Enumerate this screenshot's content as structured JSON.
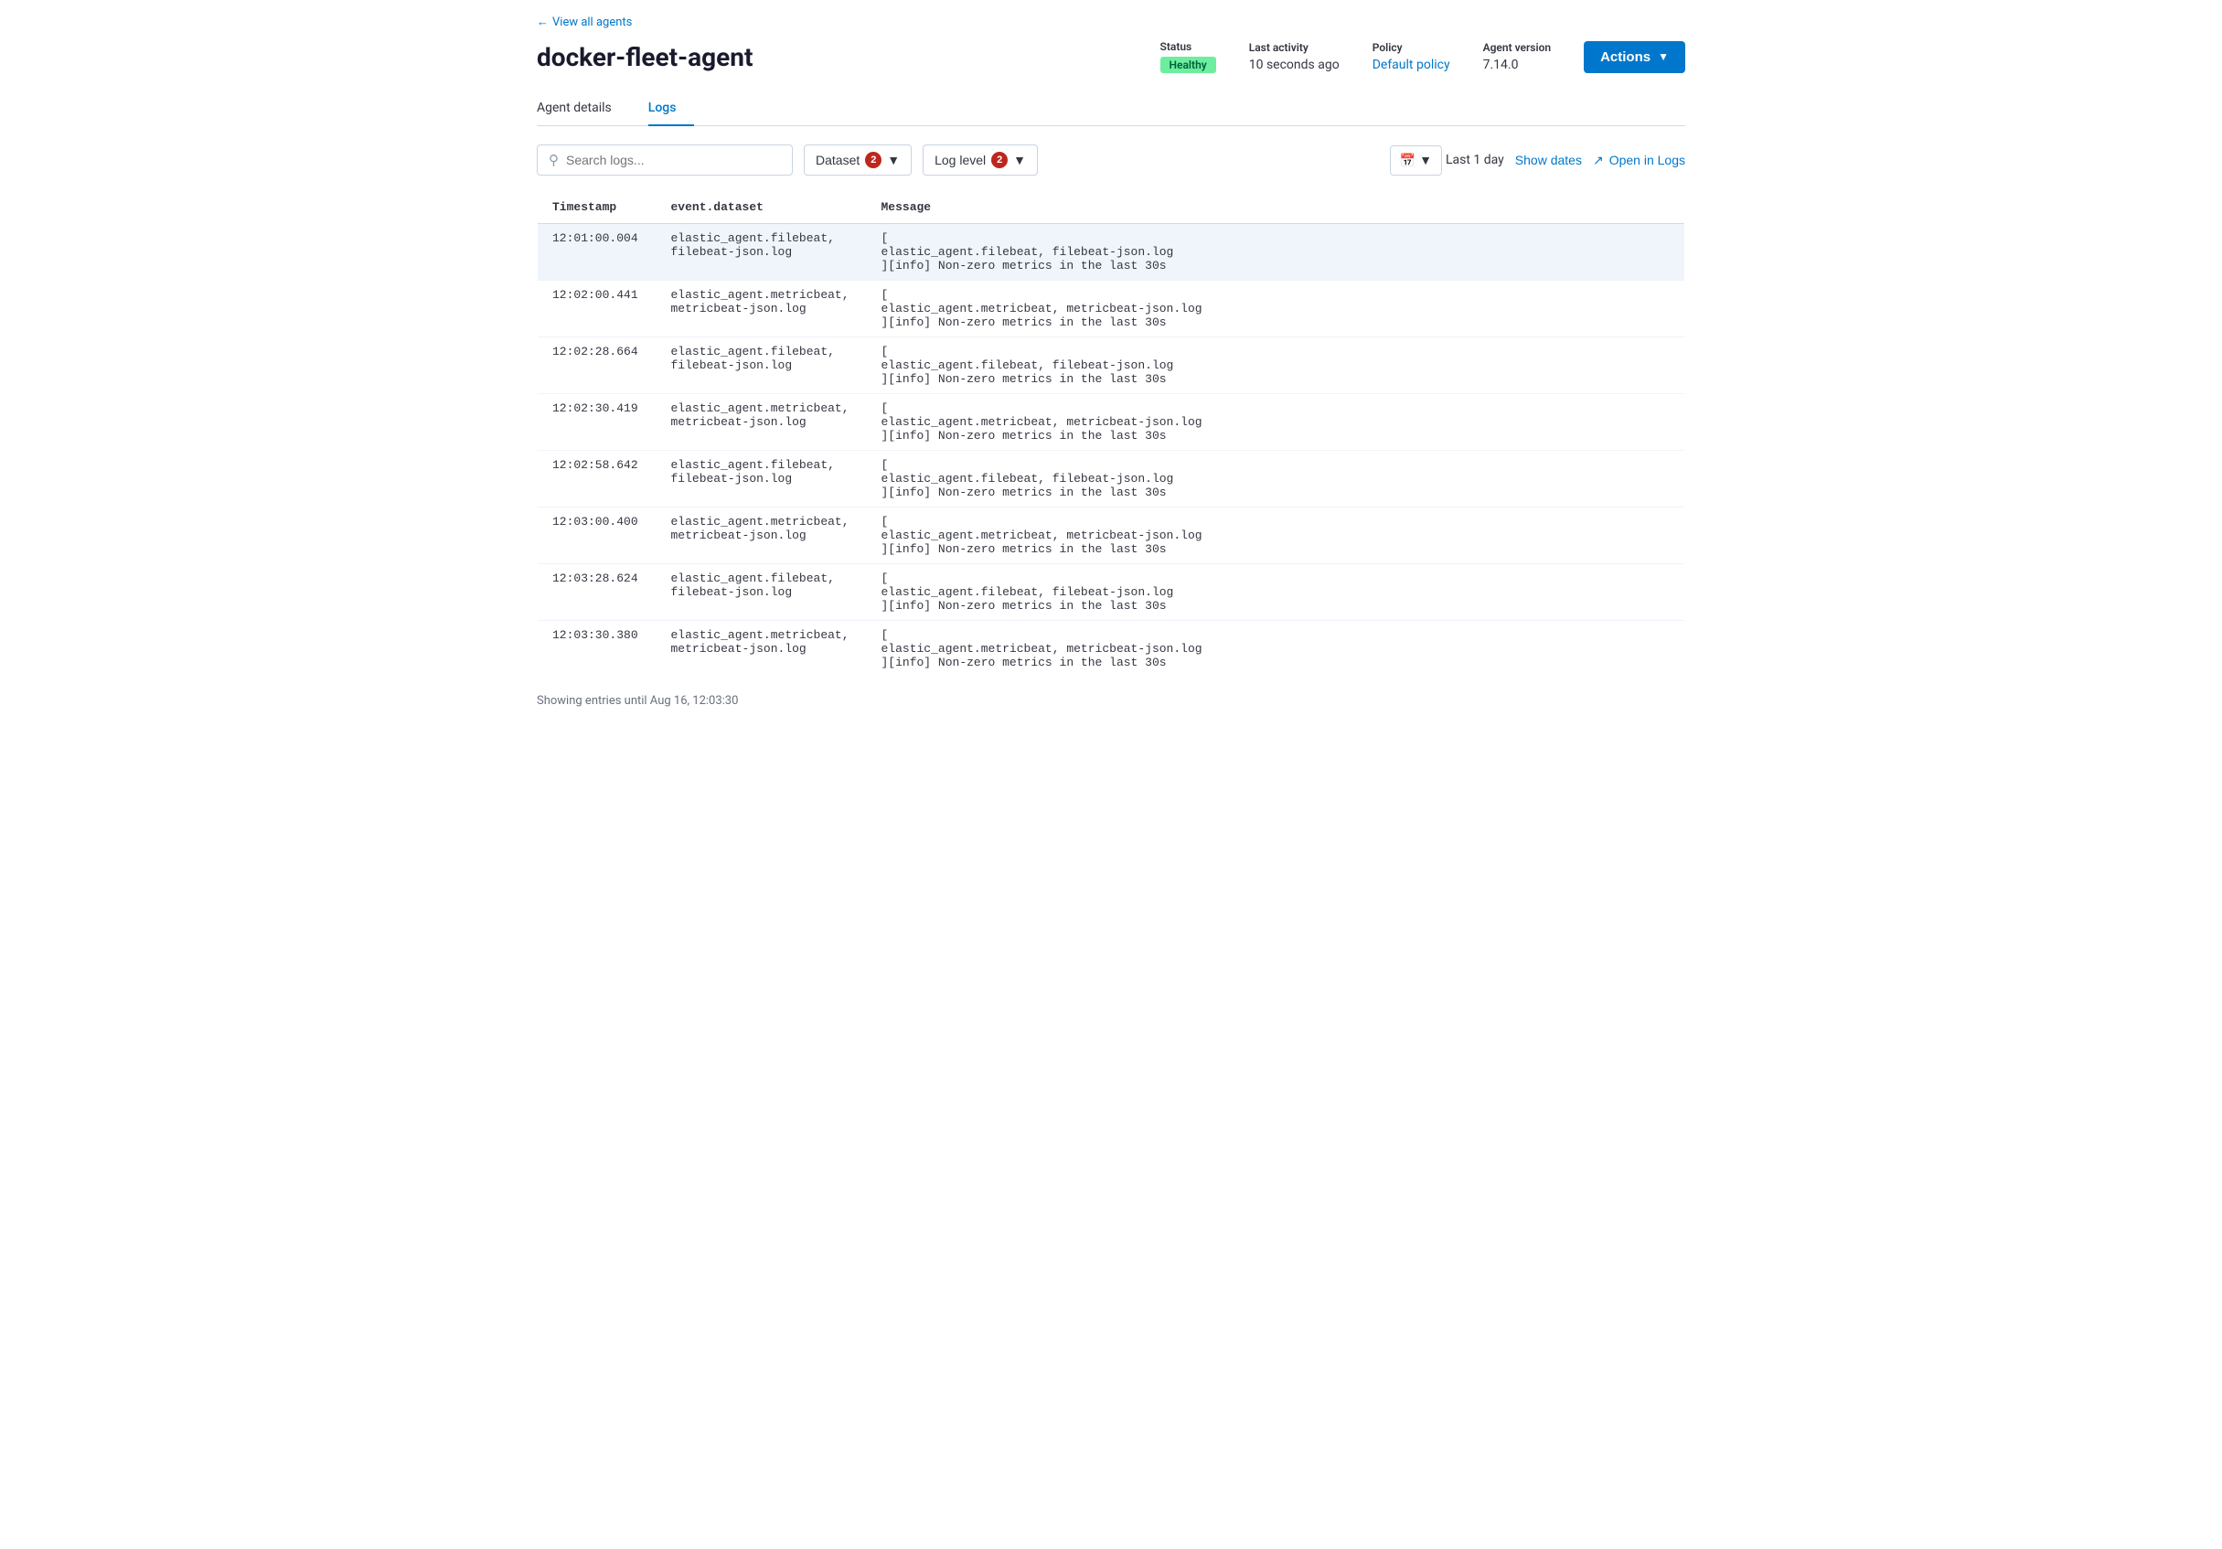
{
  "nav": {
    "back_label": "View all agents"
  },
  "header": {
    "title": "docker-fleet-agent",
    "status_label": "Status",
    "status_value": "Healthy",
    "last_activity_label": "Last activity",
    "last_activity_value": "10 seconds ago",
    "policy_label": "Policy",
    "policy_value": "Default policy",
    "agent_version_label": "Agent version",
    "agent_version_value": "7.14.0",
    "actions_label": "Actions"
  },
  "tabs": [
    {
      "id": "agent-details",
      "label": "Agent details"
    },
    {
      "id": "logs",
      "label": "Logs"
    }
  ],
  "active_tab": "logs",
  "toolbar": {
    "search_placeholder": "Search logs...",
    "dataset_label": "Dataset",
    "dataset_count": "2",
    "log_level_label": "Log level",
    "log_level_count": "2",
    "time_range": "Last 1 day",
    "show_dates_label": "Show dates",
    "open_in_logs_label": "Open in Logs"
  },
  "table": {
    "columns": [
      {
        "id": "timestamp",
        "label": "Timestamp"
      },
      {
        "id": "dataset",
        "label": "event.dataset"
      },
      {
        "id": "message",
        "label": "Message"
      }
    ],
    "rows": [
      {
        "timestamp": "12:01:00.004",
        "dataset": "elastic_agent.filebeat, filebeat-json.log",
        "message": "[\nelastic_agent.filebeat, filebeat-json.log\n][info] Non-zero metrics in the last 30s"
      },
      {
        "timestamp": "12:02:00.441",
        "dataset": "elastic_agent.metricbeat, metricbeat-json.log",
        "message": "[\nelastic_agent.metricbeat, metricbeat-json.log\n][info] Non-zero metrics in the last 30s"
      },
      {
        "timestamp": "12:02:28.664",
        "dataset": "elastic_agent.filebeat, filebeat-json.log",
        "message": "[\nelastic_agent.filebeat, filebeat-json.log\n][info] Non-zero metrics in the last 30s"
      },
      {
        "timestamp": "12:02:30.419",
        "dataset": "elastic_agent.metricbeat, metricbeat-json.log",
        "message": "[\nelastic_agent.metricbeat, metricbeat-json.log\n][info] Non-zero metrics in the last 30s"
      },
      {
        "timestamp": "12:02:58.642",
        "dataset": "elastic_agent.filebeat, filebeat-json.log",
        "message": "[\nelastic_agent.filebeat, filebeat-json.log\n][info] Non-zero metrics in the last 30s"
      },
      {
        "timestamp": "12:03:00.400",
        "dataset": "elastic_agent.metricbeat, metricbeat-json.log",
        "message": "[\nelastic_agent.metricbeat, metricbeat-json.log\n][info] Non-zero metrics in the last 30s"
      },
      {
        "timestamp": "12:03:28.624",
        "dataset": "elastic_agent.filebeat, filebeat-json.log",
        "message": "[\nelastic_agent.filebeat, filebeat-json.log\n][info] Non-zero metrics in the last 30s"
      },
      {
        "timestamp": "12:03:30.380",
        "dataset": "elastic_agent.metricbeat, metricbeat-json.log",
        "message": "[\nelastic_agent.metricbeat, metricbeat-json.log\n][info] Non-zero metrics in the last 30s"
      }
    ]
  },
  "footer": {
    "text": "Showing entries until Aug 16, 12:03:30"
  }
}
